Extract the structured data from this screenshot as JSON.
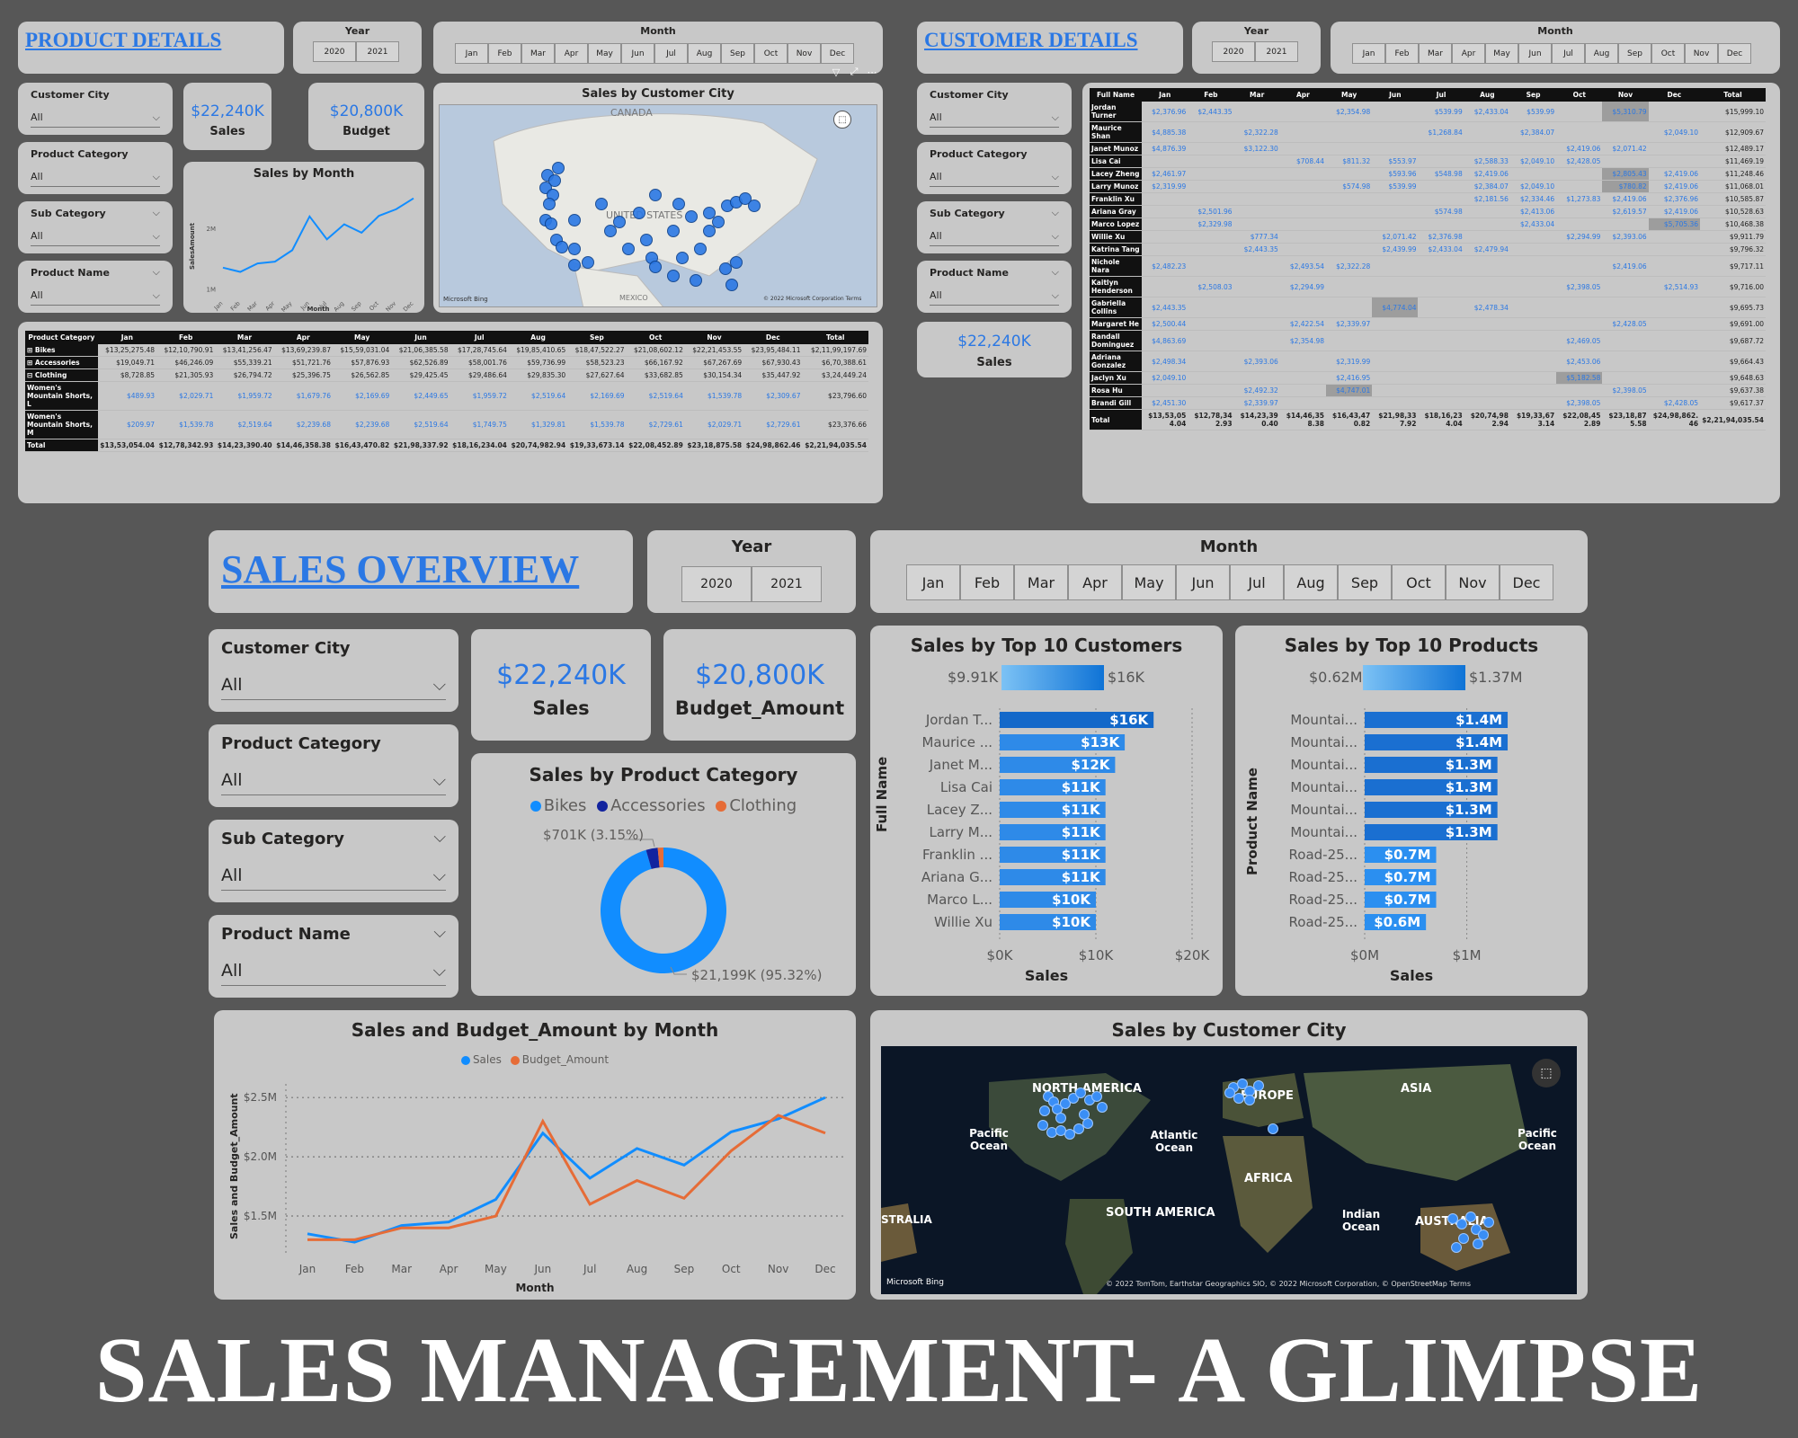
{
  "product": {
    "title": "PRODUCT DETAILS",
    "year_label": "Year",
    "years": [
      "2020",
      "2021"
    ],
    "month_label": "Month",
    "months": [
      "Jan",
      "Feb",
      "Mar",
      "Apr",
      "May",
      "Jun",
      "Jul",
      "Aug",
      "Sep",
      "Oct",
      "Nov",
      "Dec"
    ],
    "slicers": [
      {
        "title": "Customer City",
        "value": "All"
      },
      {
        "title": "Product Category",
        "value": "All"
      },
      {
        "title": "Sub Category",
        "value": "All"
      },
      {
        "title": "Product Name",
        "value": "All"
      }
    ],
    "kpi_sales": {
      "value": "$22,240K",
      "label": "Sales"
    },
    "kpi_budget": {
      "value": "$20,800K",
      "label": "Budget"
    },
    "map_title": "Sales by Customer City",
    "map_canada": "CANADA",
    "map_us": "UNITED STATES",
    "map_mexico": "MEXICO",
    "map_credit": "© 2022 Microsoft Corporation Terms",
    "map_bing": "Microsoft Bing",
    "line_title": "Sales by Month",
    "line_ylabel": "SalesAmount",
    "line_xlabel": "Month",
    "line_yticks": [
      "2M",
      "1M"
    ],
    "matrix": {
      "headers": [
        "Product Category",
        "Jan",
        "Feb",
        "Mar",
        "Apr",
        "May",
        "Jun",
        "Jul",
        "Aug",
        "Sep",
        "Oct",
        "Nov",
        "Dec",
        "Total"
      ],
      "rows": [
        [
          "⊞ Bikes",
          "$13,25,275.48",
          "$12,10,790.91",
          "$13,41,256.47",
          "$13,69,239.87",
          "$15,59,031.04",
          "$21,06,385.58",
          "$17,28,745.64",
          "$19,85,410.65",
          "$18,47,522.27",
          "$21,08,602.12",
          "$22,21,453.55",
          "$23,95,484.11",
          "$2,11,99,197.69"
        ],
        [
          "⊞ Accessories",
          "$19,049.71",
          "$46,246.09",
          "$55,339.21",
          "$51,721.76",
          "$57,876.93",
          "$62,526.89",
          "$58,001.76",
          "$59,736.99",
          "$58,523.23",
          "$66,167.92",
          "$67,267.69",
          "$67,930.43",
          "$6,70,388.61"
        ],
        [
          "⊟ Clothing",
          "$8,728.85",
          "$21,305.93",
          "$26,794.72",
          "$25,396.75",
          "$26,562.85",
          "$29,425.45",
          "$29,486.64",
          "$29,835.30",
          "$27,627.64",
          "$33,682.85",
          "$30,154.34",
          "$35,447.92",
          "$3,24,449.24"
        ],
        [
          "Women's Mountain Shorts, L",
          "$489.93",
          "$2,029.71",
          "$1,959.72",
          "$1,679.76",
          "$2,169.69",
          "$2,449.65",
          "$1,959.72",
          "$2,519.64",
          "$2,169.69",
          "$2,519.64",
          "$1,539.78",
          "$2,309.67",
          "$23,796.60"
        ],
        [
          "Women's Mountain Shorts, M",
          "$209.97",
          "$1,539.78",
          "$2,519.64",
          "$2,239.68",
          "$2,239.68",
          "$2,519.64",
          "$1,749.75",
          "$1,329.81",
          "$1,539.78",
          "$2,729.61",
          "$2,029.71",
          "$2,729.61",
          "$23,376.66"
        ]
      ],
      "total": [
        "Total",
        "$13,53,054.04",
        "$12,78,342.93",
        "$14,23,390.40",
        "$14,46,358.38",
        "$16,43,470.82",
        "$21,98,337.92",
        "$18,16,234.04",
        "$20,74,982.94",
        "$19,33,673.14",
        "$22,08,452.89",
        "$23,18,875.58",
        "$24,98,862.46",
        "$2,21,94,035.54"
      ]
    }
  },
  "customer": {
    "title": "CUSTOMER DETAILS",
    "year_label": "Year",
    "years": [
      "2020",
      "2021"
    ],
    "month_label": "Month",
    "months": [
      "Jan",
      "Feb",
      "Mar",
      "Apr",
      "May",
      "Jun",
      "Jul",
      "Aug",
      "Sep",
      "Oct",
      "Nov",
      "Dec"
    ],
    "slicers": [
      {
        "title": "Customer City",
        "value": "All"
      },
      {
        "title": "Product Category",
        "value": "All"
      },
      {
        "title": "Sub Category",
        "value": "All"
      },
      {
        "title": "Product Name",
        "value": "All"
      }
    ],
    "kpi_sales": {
      "value": "$22,240K",
      "label": "Sales"
    },
    "matrix": {
      "headers": [
        "Full Name",
        "Jan",
        "Feb",
        "Mar",
        "Apr",
        "May",
        "Jun",
        "Jul",
        "Aug",
        "Sep",
        "Oct",
        "Nov",
        "Dec",
        "Total"
      ],
      "rows": [
        [
          "Jordan Turner",
          "$2,376.96",
          "$2,443.35",
          "",
          "",
          "$2,354.98",
          "",
          "$539.99",
          "$2,433.04",
          "$539.99",
          "",
          "$5,310.79",
          "",
          "$15,999.10"
        ],
        [
          "Maurice Shan",
          "$4,885.38",
          "",
          "$2,322.28",
          "",
          "",
          "",
          "$1,268.84",
          "",
          "$2,384.07",
          "",
          "",
          "$2,049.10",
          "$12,909.67"
        ],
        [
          "Janet Munoz",
          "$4,876.39",
          "",
          "$3,122.30",
          "",
          "",
          "",
          "",
          "",
          "",
          "$2,419.06",
          "$2,071.42",
          "",
          "$12,489.17"
        ],
        [
          "Lisa Cai",
          "",
          "",
          "",
          "$708.44",
          "$811.32",
          "$553.97",
          "",
          "$2,588.33",
          "$2,049.10",
          "$2,428.05",
          "",
          "",
          "$11,469.19"
        ],
        [
          "Lacey Zheng",
          "$2,461.97",
          "",
          "",
          "",
          "",
          "$593.96",
          "$548.98",
          "$2,419.06",
          "",
          "",
          "$2,805.43",
          "$2,419.06",
          "$11,248.46"
        ],
        [
          "Larry Munoz",
          "$2,319.99",
          "",
          "",
          "",
          "$574.98",
          "$539.99",
          "",
          "$2,384.07",
          "$2,049.10",
          "",
          "$780.82",
          "$2,419.06",
          "$11,068.01"
        ],
        [
          "Franklin Xu",
          "",
          "",
          "",
          "",
          "",
          "",
          "",
          "$2,181.56",
          "$2,334.46",
          "$1,273.83",
          "$2,419.06",
          "$2,376.96",
          "$10,585.87"
        ],
        [
          "Ariana Gray",
          "",
          "$2,501.96",
          "",
          "",
          "",
          "",
          "$574.98",
          "",
          "$2,413.06",
          "",
          "$2,619.57",
          "$2,419.06",
          "$10,528.63"
        ],
        [
          "Marco Lopez",
          "",
          "$2,329.98",
          "",
          "",
          "",
          "",
          "",
          "",
          "$2,433.04",
          "",
          "",
          "$5,705.36",
          "$10,468.38"
        ],
        [
          "Willie Xu",
          "",
          "",
          "$777.34",
          "",
          "",
          "$2,071.42",
          "$2,376.98",
          "",
          "",
          "$2,294.99",
          "$2,393.06",
          "",
          "$9,911.79"
        ],
        [
          "Katrina Tang",
          "",
          "",
          "$2,443.35",
          "",
          "",
          "$2,439.99",
          "$2,433.04",
          "$2,479.94",
          "",
          "",
          "",
          "",
          "$9,796.32"
        ],
        [
          "Nichole Nara",
          "$2,482.23",
          "",
          "",
          "$2,493.54",
          "$2,322.28",
          "",
          "",
          "",
          "",
          "",
          "$2,419.06",
          "",
          "$9,717.11"
        ],
        [
          "Kaitlyn Henderson",
          "",
          "$2,508.03",
          "",
          "$2,294.99",
          "",
          "",
          "",
          "",
          "",
          "$2,398.05",
          "",
          "$2,514.93",
          "$9,716.00"
        ],
        [
          "Gabriella Collins",
          "$2,443.35",
          "",
          "",
          "",
          "",
          "$4,774.04",
          "",
          "$2,478.34",
          "",
          "",
          "",
          "",
          "$9,695.73"
        ],
        [
          "Margaret He",
          "$2,500.44",
          "",
          "",
          "$2,422.54",
          "$2,339.97",
          "",
          "",
          "",
          "",
          "",
          "$2,428.05",
          "",
          "$9,691.00"
        ],
        [
          "Randall Dominguez",
          "$4,863.69",
          "",
          "",
          "$2,354.98",
          "",
          "",
          "",
          "",
          "",
          "$2,469.05",
          "",
          "",
          "$9,687.72"
        ],
        [
          "Adriana Gonzalez",
          "$2,498.34",
          "",
          "$2,393.06",
          "",
          "$2,319.99",
          "",
          "",
          "",
          "",
          "$2,453.06",
          "",
          "",
          "$9,664.43"
        ],
        [
          "Jaclyn Xu",
          "$2,049.10",
          "",
          "",
          "",
          "$2,416.95",
          "",
          "",
          "",
          "",
          "$5,182.58",
          "",
          "",
          "$9,648.63"
        ],
        [
          "Rosa Hu",
          "",
          "",
          "$2,492.32",
          "",
          "$4,747.01",
          "",
          "",
          "",
          "",
          "",
          "$2,398.05",
          "",
          "$9,637.38"
        ],
        [
          "Brandi Gill",
          "$2,451.30",
          "",
          "$2,339.97",
          "",
          "",
          "",
          "",
          "",
          "",
          "$2,398.05",
          "",
          "$2,428.05",
          "$9,617.37"
        ]
      ],
      "total": [
        "Total",
        "$13,53,05 4.04",
        "$12,78,34 2.93",
        "$14,23,39 0.40",
        "$14,46,35 8.38",
        "$16,43,47 0.82",
        "$21,98,33 7.92",
        "$18,16,23 4.04",
        "$20,74,98 2.94",
        "$19,33,67 3.14",
        "$22,08,45 2.89",
        "$23,18,87 5.58",
        "$24,98,862. 46",
        "$2,21,94,035.54"
      ]
    }
  },
  "overview": {
    "title": "SALES OVERVIEW",
    "year_label": "Year",
    "years": [
      "2020",
      "2021"
    ],
    "month_label": "Month",
    "months": [
      "Jan",
      "Feb",
      "Mar",
      "Apr",
      "May",
      "Jun",
      "Jul",
      "Aug",
      "Sep",
      "Oct",
      "Nov",
      "Dec"
    ],
    "slicers": [
      {
        "title": "Customer City",
        "value": "All"
      },
      {
        "title": "Product Category",
        "value": "All"
      },
      {
        "title": "Sub Category",
        "value": "All"
      },
      {
        "title": "Product Name",
        "value": "All"
      }
    ],
    "kpi_sales": {
      "value": "$22,240K",
      "label": "Sales"
    },
    "kpi_budget": {
      "value": "$20,800K",
      "label": "Budget_Amount"
    },
    "donut": {
      "title": "Sales by Product Category",
      "legend": [
        "Bikes",
        "Accessories",
        "Clothing"
      ],
      "label_top": "$701K (3.15%)",
      "label_bottom": "$21,199K (95.32%)"
    },
    "top_customers": {
      "title": "Sales by Top 10 Customers",
      "range_min": "$9.91K",
      "range_max": "$16K",
      "ylabel": "Full Name",
      "xlabel": "Sales",
      "ticks": [
        "$0K",
        "$10K",
        "$20K"
      ]
    },
    "top_products": {
      "title": "Sales by Top 10 Products",
      "range_min": "$0.62M",
      "range_max": "$1.37M",
      "ylabel": "Product Name",
      "xlabel": "Sales",
      "ticks": [
        "$0M",
        "$1M"
      ]
    },
    "line": {
      "title": "Sales and Budget_Amount by Month",
      "legend": [
        "Sales",
        "Budget_Amount"
      ],
      "ylabel": "Sales and Budget_Amount",
      "xlabel": "Month",
      "yticks": [
        "$2.5M",
        "$2.0M",
        "$1.5M"
      ]
    },
    "world_map": {
      "title": "Sales by Customer City",
      "labels": [
        "NORTH AMERICA",
        "EUROPE",
        "ASIA",
        "AFRICA",
        "SOUTH AMERICA",
        "AUSTRALIA",
        "Pacific Ocean",
        "Atlantic Ocean",
        "Indian Ocean",
        "Pacific Ocean",
        "STRALIA"
      ],
      "bing": "Microsoft Bing",
      "credit": "© 2022 TomTom, Earthstar Geographics SIO, © 2022 Microsoft Corporation, © OpenStreetMap  Terms"
    }
  },
  "footer_title": "SALES MANAGEMENT- A GLIMPSE",
  "chart_data": [
    {
      "type": "line",
      "title": "Sales by Month",
      "xlabel": "Month",
      "ylabel": "SalesAmount",
      "categories": [
        "Jan",
        "Feb",
        "Mar",
        "Apr",
        "May",
        "Jun",
        "Jul",
        "Aug",
        "Sep",
        "Oct",
        "Nov",
        "Dec"
      ],
      "values": [
        1.35,
        1.28,
        1.42,
        1.45,
        1.64,
        2.2,
        1.82,
        2.07,
        1.93,
        2.21,
        2.32,
        2.5
      ],
      "ylim": [
        0.9,
        2.6
      ]
    },
    {
      "type": "pie",
      "title": "Sales by Product Category",
      "categories": [
        "Bikes",
        "Accessories",
        "Clothing"
      ],
      "values": [
        21199,
        670,
        324
      ],
      "colors": [
        "#118dff",
        "#12239e",
        "#e66c37"
      ]
    },
    {
      "type": "bar",
      "title": "Sales by Top 10 Customers",
      "xlabel": "Sales",
      "ylabel": "Full Name",
      "categories": [
        "Jordan T...",
        "Maurice ...",
        "Janet M...",
        "Lisa Cai",
        "Lacey Z...",
        "Larry M...",
        "Franklin ...",
        "Ariana G...",
        "Marco L...",
        "Willie Xu"
      ],
      "values": [
        16,
        13,
        12,
        11,
        11,
        11,
        11,
        11,
        10,
        10
      ],
      "labels": [
        "$16K",
        "$13K",
        "$12K",
        "$11K",
        "$11K",
        "$11K",
        "$11K",
        "$11K",
        "$10K",
        "$10K"
      ],
      "xlim": [
        0,
        20
      ]
    },
    {
      "type": "bar",
      "title": "Sales by Top 10 Products",
      "xlabel": "Sales",
      "ylabel": "Product Name",
      "categories": [
        "Mountai...",
        "Mountai...",
        "Mountai...",
        "Mountai...",
        "Mountai...",
        "Mountai...",
        "Road-25...",
        "Road-25...",
        "Road-25...",
        "Road-25..."
      ],
      "values": [
        1.4,
        1.4,
        1.3,
        1.3,
        1.3,
        1.3,
        0.7,
        0.7,
        0.7,
        0.6
      ],
      "labels": [
        "$1.4M",
        "$1.4M",
        "$1.3M",
        "$1.3M",
        "$1.3M",
        "$1.3M",
        "$0.7M",
        "$0.7M",
        "$0.7M",
        "$0.6M"
      ],
      "xlim": [
        0,
        1.5
      ]
    },
    {
      "type": "line",
      "title": "Sales and Budget_Amount by Month",
      "xlabel": "Month",
      "ylabel": "Sales and Budget_Amount",
      "categories": [
        "Jan",
        "Feb",
        "Mar",
        "Apr",
        "May",
        "Jun",
        "Jul",
        "Aug",
        "Sep",
        "Oct",
        "Nov",
        "Dec"
      ],
      "series": [
        {
          "name": "Sales",
          "color": "#118dff",
          "values": [
            1.35,
            1.28,
            1.42,
            1.45,
            1.64,
            2.2,
            1.82,
            2.07,
            1.93,
            2.21,
            2.32,
            2.5
          ]
        },
        {
          "name": "Budget_Amount",
          "color": "#e66c37",
          "values": [
            1.3,
            1.3,
            1.4,
            1.4,
            1.5,
            2.3,
            1.6,
            1.8,
            1.65,
            2.05,
            2.35,
            2.2
          ]
        }
      ],
      "ylim": [
        1.2,
        2.6
      ]
    }
  ]
}
